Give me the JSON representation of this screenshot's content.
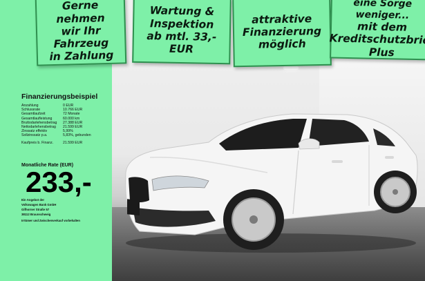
{
  "banners": {
    "card1": "Gerne nehmen\nwir Ihr\nFahrzeug\nin Zahlung",
    "card2": "Wartung &\nInspektion\nab mtl. 33,- EUR",
    "card3": "attraktive\nFinanzierung\nmöglich",
    "card4_line1": "eine Sorge weniger...",
    "card4_line2": "mit dem\nKreditschutzbrief\nPlus"
  },
  "financing": {
    "title": "Finanzierungsbeispiel",
    "rows": [
      {
        "label": "Anzahlung",
        "value": "0 EUR"
      },
      {
        "label": "Schlussrate",
        "value": "10.766 EUR"
      },
      {
        "label": "Gesamtlaufzeit",
        "value": "72 Monate"
      },
      {
        "label": "Gesamtlaufleistung",
        "value": "60.000 km"
      },
      {
        "label": "Bruttodarlehensbetrag",
        "value": "27.388 EUR"
      },
      {
        "label": "Nettodarlehensbetrag",
        "value": "21.599 EUR"
      },
      {
        "label": "Zinssatz effektiv",
        "value": "5,99%"
      },
      {
        "label": "Sollzinssatz p.a.",
        "value": "5,83%, gebunden"
      }
    ],
    "purchase": {
      "label": "Kaufpreis b. Finanz.",
      "value": "21.599 EUR"
    }
  },
  "rate": {
    "label": "Monatliche Rate (EUR)",
    "value": "233,-"
  },
  "bank": {
    "line1": "Ein Angebot der",
    "line2": "Volkswagen Bank GmbH",
    "line3": "Gifhorner Straße 57",
    "line4": "38112 Braunschweig"
  },
  "note": "Irrtümer und Zwischenverkauf vorbehalten",
  "colors": {
    "panel_green": "#7ef0a8",
    "card_border": "#2f8f4f",
    "car_body": "#f5f5f5"
  }
}
